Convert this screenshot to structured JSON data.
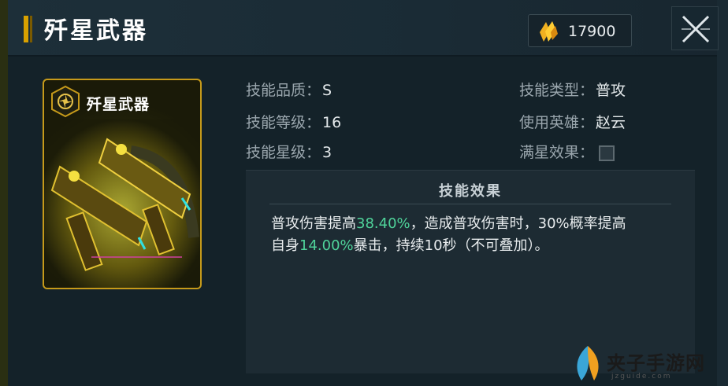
{
  "header": {
    "title": "歼星武器",
    "currency_icon": "gold-crystal-icon",
    "currency_amount": "17900",
    "close_icon": "close-icon"
  },
  "card": {
    "title": "歼星武器",
    "emblem_icon": "aperture-emblem-icon",
    "art": "twin-pistol-weapon-art"
  },
  "stats": {
    "quality_label": "技能品质：",
    "quality_value": "S",
    "level_label": "技能等级：",
    "level_value": "16",
    "star_label": "技能星级：",
    "star_value": "3",
    "type_label": "技能类型：",
    "type_value": "普攻",
    "hero_label": "使用英雄：",
    "hero_value": "赵云",
    "maxstar_label": "满星效果："
  },
  "effect": {
    "title": "技能效果",
    "line1_a": "普攻伤害提高",
    "line1_hl": "38.40%",
    "line1_b": "，造成普攻伤害时，30%概率提高",
    "line2_a": "自身",
    "line2_hl": "14.00%",
    "line2_b": "暴击，持续10秒（不可叠加）。"
  },
  "colors": {
    "highlight": "#4fd39a",
    "accent_gold": "#d9a100"
  },
  "watermark": {
    "text": "夹子手游网",
    "sub": "jzguide.com"
  }
}
